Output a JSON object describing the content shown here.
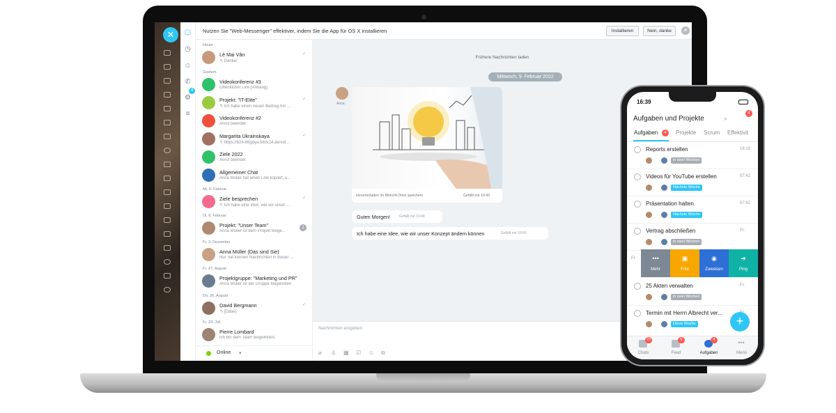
{
  "banner": {
    "text": "Nutzen Sie \"Web-Messenger\" effektiver, indem Sie die App für OS X installieren",
    "install": "Installieren",
    "decline": "Nein, danke"
  },
  "rail_badge": "4",
  "sections": [
    "Heute",
    "Gestern",
    "Mi, 9. Februar",
    "Di, 8. Februar",
    "Fr, 3. Dezember",
    "Fr, 27. August",
    "Do, 26. August",
    "Fr, 23. Juli"
  ],
  "chats": [
    {
      "name": "Lê Mai Vân",
      "sub": "↰ Danke!",
      "color": "#c79a7d"
    },
    {
      "name": "Videokonferenz #3",
      "sub": "Öffentlicher Link [Anhang]",
      "color": "#2fc26a"
    },
    {
      "name": "Projekt: \"IT-Elite\"",
      "sub": "↰ Ich habe einen neuen Beitrag Am ...",
      "color": "#9acc42"
    },
    {
      "name": "Videokonferenz #2",
      "sub": "Anruf beendet",
      "color": "#f04f3c"
    },
    {
      "name": "Margarita Ukrainskaya",
      "sub": "↰ https://b24-66gdya.bitrix24.de/vid...",
      "color": "#a07060"
    },
    {
      "name": "Ziele 2022",
      "sub": "Anruf beendet",
      "color": "#2fc26a"
    },
    {
      "name": "Allgemeiner Chat",
      "sub": "Anna Müller hat einen Link kopiert, u...",
      "color": "#2e6fb7"
    },
    {
      "name": "Ziele besprechen",
      "sub": "↰ Ich habe eine Idee, wie wir unser ...",
      "color": "#f46a8e"
    },
    {
      "name": "Projekt: \"Unser Team\"",
      "sub": "Anna Müller ist dem Projekt beige...",
      "color": "#b08a70",
      "count": "1"
    },
    {
      "name": "Anna Müller (Das sind Sie)",
      "sub": "Nur Sie können Nachrichten in dieser ...",
      "color": "#c9a184"
    },
    {
      "name": "Projektgruppe: \"Marketing und PR\"",
      "sub": "Anna Müller ist der Gruppe beigetreten",
      "color": "#6a7c90"
    },
    {
      "name": "David Bergmann",
      "sub": "↰ [Datei]",
      "color": "#8e7060"
    },
    {
      "name": "Pierre Lombard",
      "sub": "Ich bin dem Team beigetreten.",
      "color": "#9c8572"
    }
  ],
  "status": "Online",
  "conversation": {
    "earlier": "Frühere Nachrichten laden",
    "date": "Mittwoch, 9. Februar 2022",
    "sender": "Anna",
    "image_caption": "Herunterladen   Im Bitrix24.Drive speichern",
    "image_meta": "Gefällt mir   10:49",
    "messages": [
      {
        "text": "Guten Morgen!",
        "meta": "Gefällt mir   10:49"
      },
      {
        "text": "Ich habe eine Idee, wie wir unser Konzept ändern können",
        "meta": "Gefällt mir   10:50"
      }
    ],
    "input_placeholder": "Nachrichten eingeben"
  },
  "phone": {
    "time": "16:39",
    "title": "Aufgaben und Projekte",
    "header_badge": "4",
    "tabs": [
      "Aufgaben",
      "Projekte",
      "Scrum",
      "Effektivit"
    ],
    "tab_badge": "4",
    "tasks": [
      {
        "title": "Reports erstellen",
        "time": "16:19",
        "tag": "in zwei Wochen",
        "tagcolor": "#a8adb4"
      },
      {
        "title": "Videos für YouTube erstellen",
        "time": "07:42",
        "tag": "Nächste Woche",
        "tagcolor": "#2fc6f6"
      },
      {
        "title": "Präsentation halten",
        "time": "07:42",
        "tag": "Nächste Woche",
        "tagcolor": "#2fc6f6"
      },
      {
        "title": "Vertrag abschließen",
        "time": "Fr.",
        "tag": "in zwei Wochen",
        "tagcolor": "#a8adb4"
      },
      {
        "title": "25 Akten verwalten",
        "time": "Fr.",
        "tag": "in zwei Wochen",
        "tagcolor": "#a8adb4"
      },
      {
        "title": "Termin mit Herrn Albrecht ver...",
        "time": "Fr.",
        "tag": "Diese Woche",
        "tagcolor": "#2fc6f6"
      }
    ],
    "swipe_day": "Fr.",
    "swipe_actions": [
      {
        "label": "Mehr",
        "icon": "•••",
        "color": "#7d8895"
      },
      {
        "label": "Frist",
        "icon": "▣",
        "color": "#f7a700"
      },
      {
        "label": "Zuweisen",
        "icon": "◉",
        "color": "#2e6fd6"
      },
      {
        "label": "Ping",
        "icon": "➔",
        "color": "#10b2a6"
      }
    ],
    "nav": [
      {
        "label": "Chats",
        "badge": "22"
      },
      {
        "label": "Feed",
        "badge": "6"
      },
      {
        "label": "Aufgaben",
        "badge": "4"
      },
      {
        "label": "Menü",
        "badge": ""
      }
    ]
  }
}
